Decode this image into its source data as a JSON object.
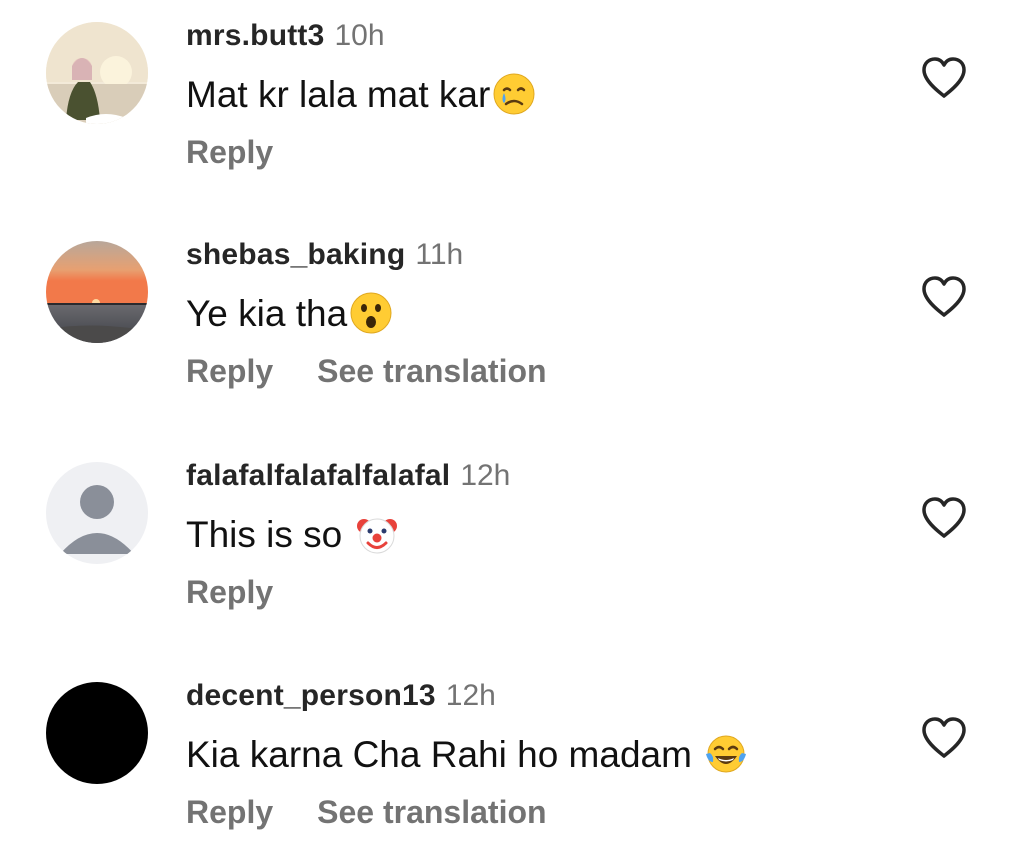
{
  "comments": [
    {
      "username": "mrs.butt3",
      "time": "10h",
      "text": "Mat kr lala mat kar",
      "emoji": "crying-face",
      "actions": [
        "Reply"
      ]
    },
    {
      "username": "shebas_baking",
      "time": "11h",
      "text": "Ye kia tha",
      "emoji": "astonished-face",
      "actions": [
        "Reply",
        "See translation"
      ]
    },
    {
      "username": "falafalfalafalfalafal",
      "time": "12h",
      "text": "This is so ",
      "emoji": "clown-face",
      "actions": [
        "Reply"
      ]
    },
    {
      "username": "decent_person13",
      "time": "12h",
      "text": "Kia karna Cha Rahi ho madam ",
      "emoji": "tears-of-joy-face",
      "actions": [
        "Reply",
        "See translation"
      ]
    }
  ],
  "colors": {
    "username": "#262626",
    "secondary": "#737373",
    "text": "#111111",
    "icon": "#262626",
    "emoji_yellow": "#FFCC33"
  }
}
